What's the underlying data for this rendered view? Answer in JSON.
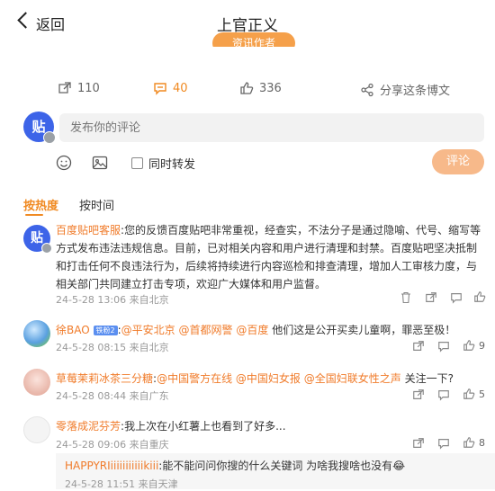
{
  "nav": {
    "back_label": "返回",
    "title": "上官正义"
  },
  "post": {
    "author_tag": "资讯作者",
    "repost_count": "110",
    "comment_count": "40",
    "like_count": "336",
    "share_label": "分享这条博文"
  },
  "composer": {
    "avatar_glyph": "贴",
    "placeholder": "发布你的评论",
    "repost_label": "同时转发",
    "submit_label": "评论"
  },
  "tabs": {
    "hot": "按热度",
    "time": "按时间"
  },
  "comments": [
    {
      "name": "百度贴吧客服",
      "avatar_glyph": "贴",
      "text": "您的反馈百度贴吧非常重视，经查实，不法分子是通过隐喻、代号、缩写等方式发布违法违规信息。目前，已对相关内容和用户进行清理和封禁。百度贴吧坚决抵制和打击任何不良违法行为，后续将持续进行内容巡检和排查清理，增加人工审核力度，与相关部门共同建立打击专项，欢迎广大媒体和用户监督。",
      "meta": "24-5-28 13:06 来自北京",
      "like_count": ""
    },
    {
      "name": "徐BAO",
      "badge": "铁粉2",
      "mentions": [
        "@平安北京",
        "@首都网警",
        "@百度"
      ],
      "text": "他们这是公开买卖儿童啊，罪恶至极！",
      "meta": "24-5-28 08:15 来自北京",
      "like_count": "9"
    },
    {
      "name": "草莓茉莉冰茶三分糖",
      "mentions": [
        "@中国警方在线",
        "@中国妇女报",
        "@全国妇联女性之声"
      ],
      "text": "关注一下?",
      "meta": "24-5-28 08:44 来自广东",
      "like_count": "5"
    },
    {
      "name": "零落成泥芬芳",
      "text": "我上次在小红薯上也看到了好多...",
      "meta": "24-5-28 09:06 来自重庆",
      "like_count": "8"
    }
  ],
  "reply": {
    "name": "HAPPYRIiiiiiiiiiiikiii",
    "text": "能不能问问你搜的什么关键词 为啥我搜啥也没有",
    "emoji": "😂",
    "meta": "24-5-28 11:51 来自天津"
  },
  "colors": {
    "accent": "#f08a22",
    "name": "#f07b2a",
    "tieba_blue": "#3d64e8",
    "submit_disabled": "#f7b98a"
  }
}
